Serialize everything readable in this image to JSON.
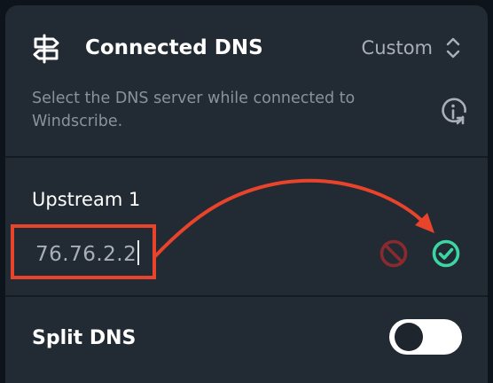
{
  "connected_dns": {
    "title": "Connected DNS",
    "mode": "Custom",
    "description": "Select the DNS server while connected to Windscribe."
  },
  "upstream": {
    "label": "Upstream 1",
    "value": "76.76.2.2"
  },
  "split_dns": {
    "label": "Split DNS",
    "enabled": false
  },
  "icons": {
    "header": "signpost-icon",
    "mode": "updown-chevron-icon",
    "info": "info-icon",
    "cancel": "prohibited-icon",
    "confirm": "check-circle-icon"
  },
  "colors": {
    "card_background": "#222a33",
    "page_background": "#0e141b",
    "annotation": "#e8432b",
    "confirm": "#3bd6a2",
    "cancel": "#8a2a2e"
  }
}
